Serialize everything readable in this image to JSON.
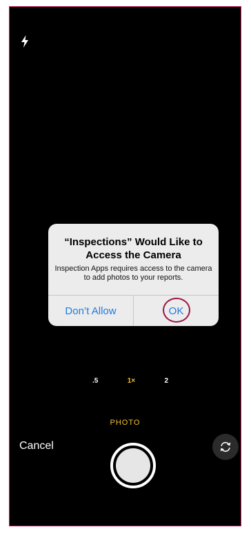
{
  "camera": {
    "flash_icon": "bolt-icon",
    "zoom_levels": [
      ".5",
      "1×",
      "2"
    ],
    "mode": "PHOTO",
    "cancel_label": "Cancel",
    "flip_icon": "camera-flip-icon"
  },
  "alert": {
    "title": "“Inspections” Would Like to Access the Camera",
    "message": "Inspection Apps requires access to the camera to add photos to your reports.",
    "deny_label": "Don’t Allow",
    "allow_label": "OK"
  },
  "colors": {
    "accent": "#f3c12f",
    "button_blue": "#1e7be6",
    "highlight": "#9c1440"
  }
}
